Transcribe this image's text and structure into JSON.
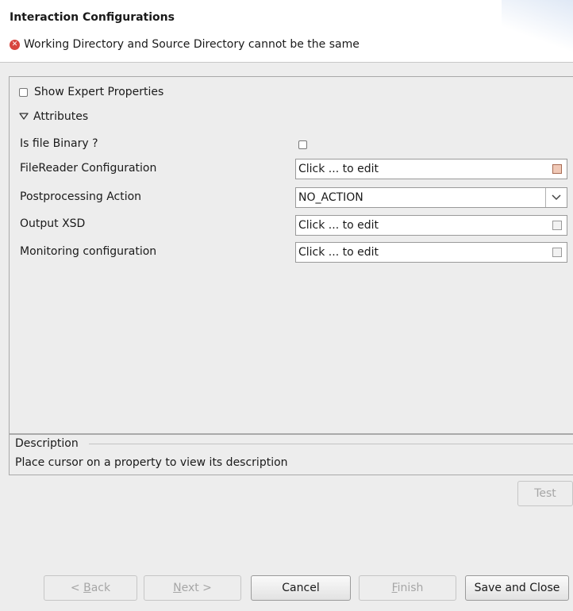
{
  "header": {
    "title": "Interaction Configurations",
    "error_message": "Working Directory and Source Directory cannot be the same",
    "error_icon": "error-icon",
    "error_color": "#d8453e"
  },
  "properties": {
    "show_expert_label": "Show Expert Properties",
    "show_expert_checked": false,
    "attributes_label": "Attributes",
    "is_file_binary": {
      "label": "Is file Binary ?",
      "checked": false
    },
    "filereader_config": {
      "label": "FileReader Configuration",
      "value": "Click ... to edit"
    },
    "postprocessing_action": {
      "label": "Postprocessing Action",
      "value": "NO_ACTION"
    },
    "output_xsd": {
      "label": "Output XSD",
      "value": "Click ... to edit"
    },
    "monitoring_config": {
      "label": "Monitoring configuration",
      "value": "Click ... to edit"
    }
  },
  "description": {
    "title": "Description",
    "text": "Place cursor on a property to view its description"
  },
  "buttons": {
    "test": "Test",
    "back_prefix": "< ",
    "back_mnemonic": "B",
    "back_rest": "ack",
    "next_mnemonic": "N",
    "next_rest": "ext >",
    "cancel": "Cancel",
    "finish_mnemonic": "F",
    "finish_rest": "inish",
    "save_close": "Save and Close"
  }
}
